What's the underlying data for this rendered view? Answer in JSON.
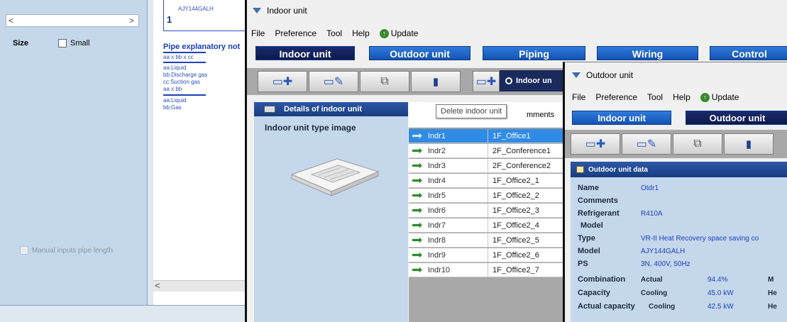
{
  "bg": {
    "scroll_left": "<",
    "scroll_right": ">",
    "size_label": "Size",
    "small_label": "Small",
    "manual_label": "Manual inputs pipe length",
    "card_model": "AJY144GALH",
    "card_num": "1",
    "pipe_title": "Pipe explanatory not",
    "pipe_lines": [
      "aa x bb x cc",
      "aa:Liquid",
      "bb:Discharge gas",
      "cc:Suction gas",
      "aa x bb",
      "aa:Liquid",
      "bb:Gas"
    ],
    "hscroll_left": "<"
  },
  "indoor": {
    "title": "Indoor unit",
    "menu": [
      "File",
      "Preference",
      "Tool",
      "Help"
    ],
    "update_label": "Update",
    "nav": [
      "Indoor unit",
      "Outdoor unit",
      "Piping",
      "Wiring",
      "Control"
    ],
    "radio_label": "Indoor un",
    "details_title": "Details of indoor unit",
    "type_image_label": "Indoor unit type image",
    "tooltip": "Delete indoor unit",
    "comments_header": "mments",
    "rows": [
      {
        "name": "Indr1",
        "comment": "1F_Office1"
      },
      {
        "name": "Indr2",
        "comment": "2F_Conference1"
      },
      {
        "name": "Indr3",
        "comment": "2F_Conference2"
      },
      {
        "name": "Indr4",
        "comment": "1F_Office2_1"
      },
      {
        "name": "Indr5",
        "comment": "1F_Office2_2"
      },
      {
        "name": "Indr6",
        "comment": "1F_Office2_3"
      },
      {
        "name": "Indr7",
        "comment": "1F_Office2_4"
      },
      {
        "name": "Indr8",
        "comment": "1F_Office2_5"
      },
      {
        "name": "Indr9",
        "comment": "1F_Office2_6"
      },
      {
        "name": "Indr10",
        "comment": "1F_Office2_7"
      }
    ]
  },
  "outdoor": {
    "title": "Outdoor unit",
    "menu": [
      "File",
      "Preference",
      "Tool",
      "Help"
    ],
    "update_label": "Update",
    "nav": [
      "Indoor unit",
      "Outdoor unit"
    ],
    "data_title": "Outdoor unit data",
    "name_label": "Name",
    "name_value": "Otdr1",
    "comments_label": "Comments",
    "refrigerant_label": "Refrigerant",
    "refrigerant_value": "R410A",
    "model_section": "Model",
    "type_label": "Type",
    "type_value": "VR-II Heat Recovery space saving co",
    "model_label": "Model",
    "model_value": "AJY144GALH",
    "ps_label": "PS",
    "ps_value": "3N, 400V, 50Hz",
    "combination_label": "Combination",
    "actual_label": "Actual",
    "combination_value": "94.4%",
    "combination_extra": "M",
    "capacity_label": "Capacity",
    "cooling_label": "Cooling",
    "capacity_value": "45.0 kW",
    "capacity_extra": "He",
    "actual_capacity_label": "Actual capacity",
    "actual_cooling_label": "Cooling",
    "actual_capacity_value": "42.5 kW",
    "actual_capacity_extra": "He"
  }
}
